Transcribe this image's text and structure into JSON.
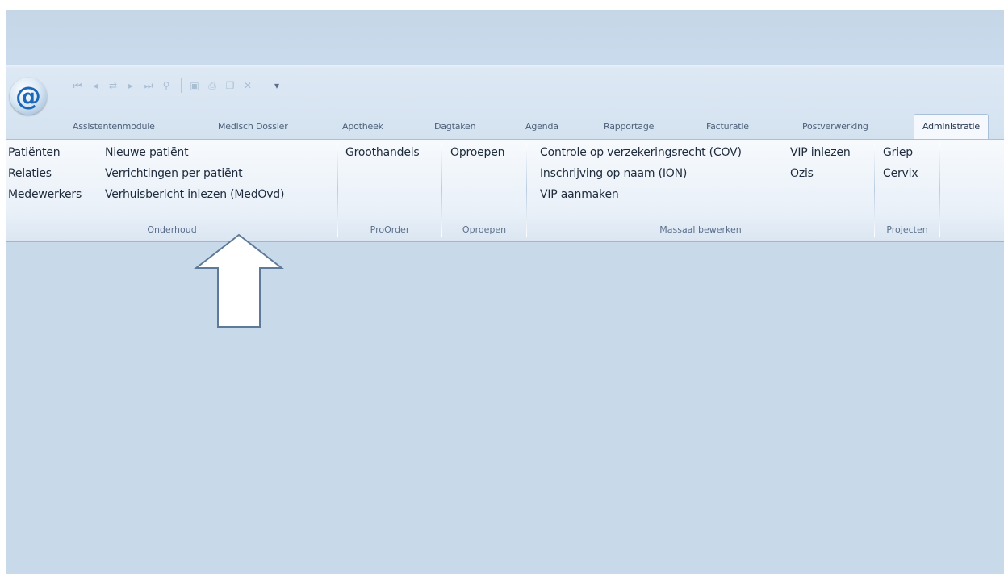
{
  "app": {
    "logo_glyph": "@",
    "quick_access": [
      "first-record-icon",
      "previous-record-icon",
      "refresh-icon",
      "next-record-icon",
      "last-record-icon",
      "search-icon",
      "save-icon",
      "print-icon",
      "copy-icon",
      "delete-icon"
    ],
    "qat_overflow_glyph": "▾"
  },
  "tabs": [
    {
      "label": "Assistentenmodule"
    },
    {
      "label": "Medisch Dossier"
    },
    {
      "label": "Apotheek"
    },
    {
      "label": "Dagtaken"
    },
    {
      "label": "Agenda"
    },
    {
      "label": "Rapportage"
    },
    {
      "label": "Facturatie"
    },
    {
      "label": "Postverwerking"
    },
    {
      "label": "Administratie",
      "active": true
    }
  ],
  "ribbon": {
    "onderhoud": {
      "label": "Onderhoud",
      "col1": [
        "Patiënten",
        "Relaties",
        "Medewerkers"
      ],
      "col2": [
        "Nieuwe patiënt",
        "Verrichtingen per patiënt",
        "Verhuisbericht inlezen (MedOvd)"
      ]
    },
    "proorder": {
      "label": "ProOrder",
      "items": [
        "Groothandels"
      ]
    },
    "oproepen": {
      "label": "Oproepen",
      "items": [
        "Oproepen"
      ]
    },
    "massaal_bewerken": {
      "label": "Massaal bewerken",
      "col1": [
        "Controle op verzekeringsrecht (COV)",
        "Inschrijving op naam (ION)",
        "VIP aanmaken"
      ],
      "col2": [
        "VIP inlezen",
        "Ozis"
      ]
    },
    "projecten": {
      "label": "Projecten",
      "items": [
        "Griep",
        "Cervix"
      ]
    }
  },
  "colors": {
    "background": "#c8daea",
    "ribbon": "#f5f9fd",
    "logo": "#1b67b8",
    "arrow_fill": "#ffffff",
    "arrow_stroke": "#5d7a99"
  }
}
